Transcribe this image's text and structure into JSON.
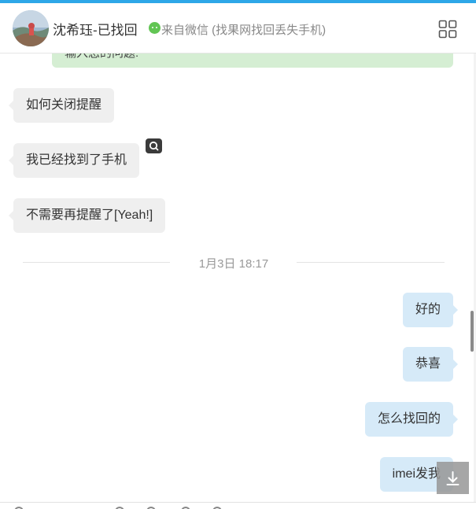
{
  "header": {
    "contact_name": "沈希珏-已找回",
    "source_label": "来自微信 (找果网找回丢失手机)"
  },
  "chat": {
    "top_note": "输入您的问题:",
    "messages": [
      {
        "direction": "incoming",
        "text": "如何关闭提醒"
      },
      {
        "direction": "incoming",
        "text": "我已经找到了手机"
      },
      {
        "direction": "incoming",
        "text": "不需要再提醒了[Yeah!]"
      },
      {
        "direction": "outgoing",
        "text": "好的"
      },
      {
        "direction": "outgoing",
        "text": "恭喜"
      },
      {
        "direction": "outgoing",
        "text": "怎么找回的"
      },
      {
        "direction": "outgoing",
        "text": "imei发我"
      }
    ],
    "timestamp": "1月3日 18:17"
  },
  "colors": {
    "accent": "#2ea7e8",
    "incoming_bubble": "#efefef",
    "outgoing_bubble": "#d6eaf8",
    "note_bg": "#d5eed3",
    "wechat_green": "#62c554"
  },
  "icons": [
    "avatar",
    "wechat-icon",
    "grid-icon",
    "search-icon",
    "scroll-down-icon"
  ]
}
